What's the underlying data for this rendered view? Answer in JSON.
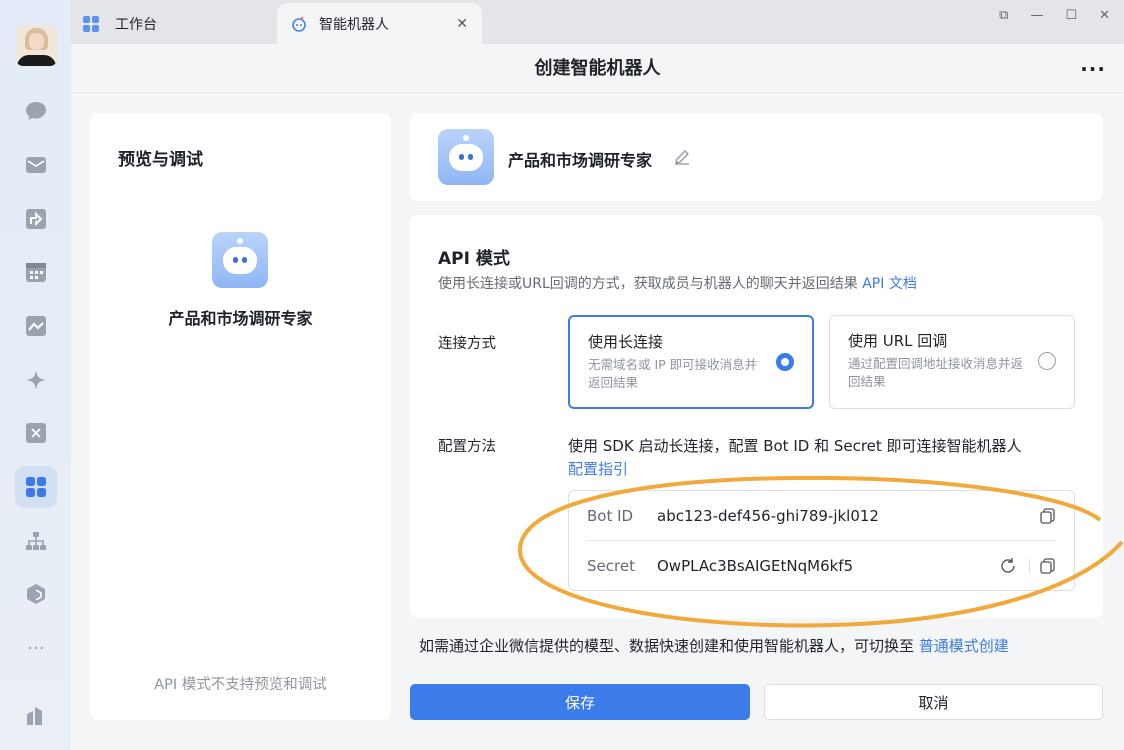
{
  "tabs": [
    {
      "label": "工作台"
    },
    {
      "label": "智能机器人"
    }
  ],
  "header": {
    "title": "创建智能机器人",
    "more": "···"
  },
  "preview": {
    "title": "预览与调试",
    "bot_name": "产品和市场调研专家",
    "notice": "API 模式不支持预览和调试"
  },
  "bot": {
    "name": "产品和市场调研专家"
  },
  "api": {
    "title": "API 模式",
    "desc": "使用长连接或URL回调的方式，获取成员与机器人的聊天并返回结果",
    "doc_link": "API 文档",
    "connect_label": "连接方式",
    "options": [
      {
        "title": "使用长连接",
        "desc": "无需域名或 IP 即可接收消息并返回结果",
        "selected": true
      },
      {
        "title": "使用 URL 回调",
        "desc": "通过配置回调地址接收消息并返回结果",
        "selected": false
      }
    ],
    "config_label": "配置方法",
    "config_desc": "使用 SDK 启动长连接，配置 Bot ID 和 Secret 即可连接智能机器人",
    "config_link": "配置指引",
    "bot_id_label": "Bot ID",
    "bot_id": "abc123-def456-ghi789-jkl012",
    "secret_label": "Secret",
    "secret": "OwPLAc3BsAIGEtNqM6kf5"
  },
  "footer": {
    "text": "如需通过企业微信提供的模型、数据快速创建和使用智能机器人，可切换至",
    "link": "普通模式创建"
  },
  "buttons": {
    "save": "保存",
    "cancel": "取消"
  },
  "colors": {
    "accent": "#3c7bea",
    "annotation": "#f0a93a"
  }
}
